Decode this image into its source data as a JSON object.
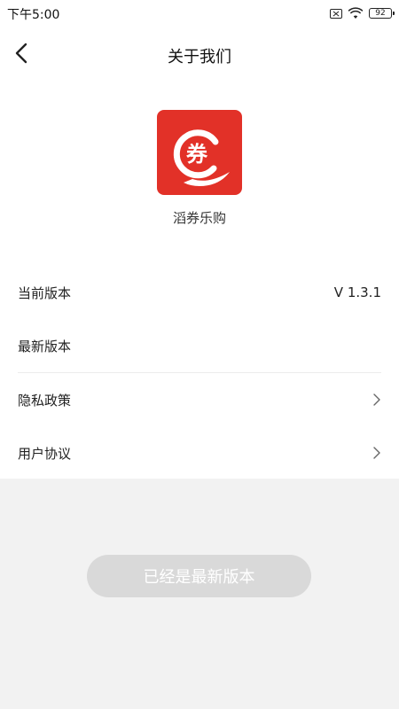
{
  "status_bar": {
    "time": "下午5:00",
    "battery": "92",
    "icons": [
      "sim-disabled-icon",
      "wifi-icon",
      "battery-icon"
    ]
  },
  "header": {
    "title": "关于我们",
    "back_icon": "chevron-left-icon"
  },
  "app": {
    "name": "滔券乐购",
    "logo_text": "券",
    "logo_color": "#e23128"
  },
  "list": {
    "current_version_label": "当前版本",
    "current_version_value": "V 1.3.1",
    "latest_version_label": "最新版本",
    "privacy_label": "隐私政策",
    "agreement_label": "用户协议"
  },
  "footer": {
    "button_label": "已经是最新版本"
  }
}
